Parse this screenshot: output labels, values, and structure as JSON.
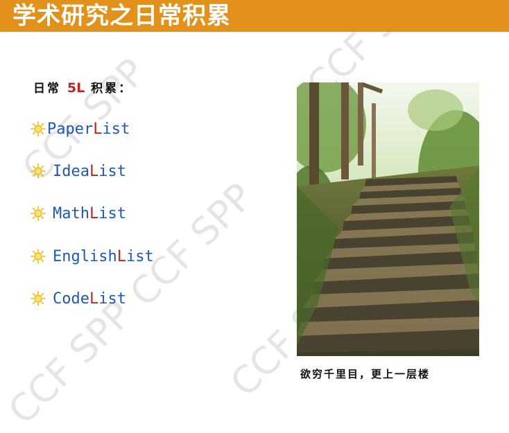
{
  "title": "学术研究之日常积累",
  "heading": {
    "prefix": "日常 ",
    "highlight": "5L",
    "suffix": " 积累："
  },
  "items": [
    {
      "name": "Paper ",
      "l": "L",
      "rest": "ist"
    },
    {
      "name": "Idea ",
      "l": "L",
      "rest": "ist"
    },
    {
      "name": "Math ",
      "l": "L",
      "rest": "ist"
    },
    {
      "name": "English ",
      "l": "L",
      "rest": "ist"
    },
    {
      "name": "Code ",
      "l": "L",
      "rest": "ist"
    }
  ],
  "caption": "欲穷千里目，更上一层楼",
  "watermark": "CCF SPP",
  "colors": {
    "title_bar": "#e2921a",
    "item_text": "#1e57b5",
    "accent_red": "#c0231f",
    "sun": "#f2b400"
  },
  "icons": {
    "bullet": "sun-icon"
  }
}
